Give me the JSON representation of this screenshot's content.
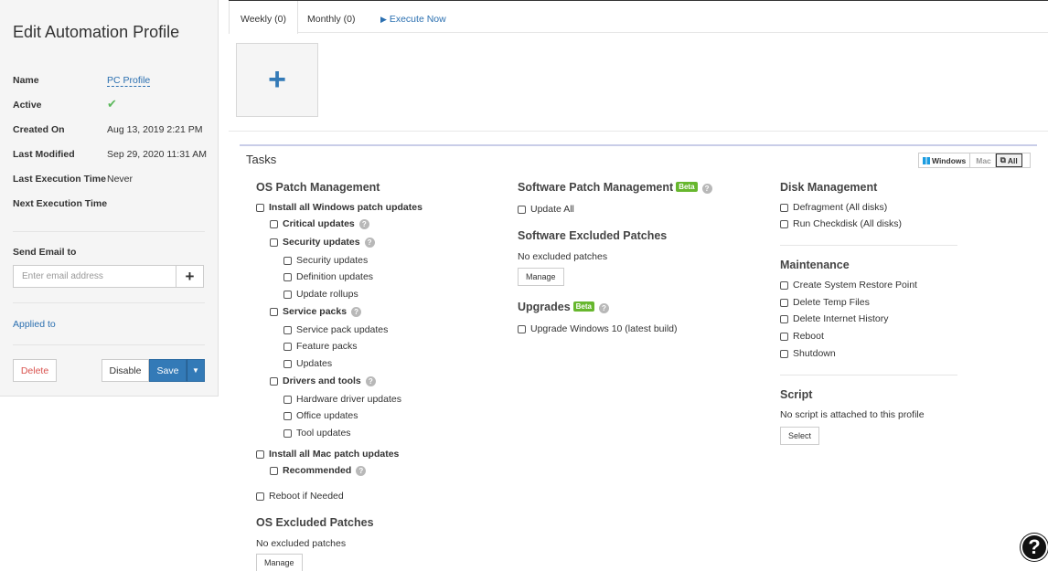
{
  "profile": {
    "title": "Edit Automation Profile",
    "name_label": "Name",
    "name_value": "PC Profile",
    "active_label": "Active",
    "created_label": "Created On",
    "created_value": "Aug 13, 2019 2:21 PM",
    "modified_label": "Last Modified",
    "modified_value": "Sep 29, 2020 11:31 AM",
    "last_exec_label": "Last Execution Time",
    "last_exec_value": "Never",
    "next_exec_label": "Next Execution Time",
    "send_email_label": "Send Email to",
    "email_placeholder": "Enter email address",
    "add_symbol": "+",
    "applied_to": "Applied to",
    "delete_label": "Delete",
    "disable_label": "Disable",
    "save_label": "Save",
    "caret": "▼"
  },
  "tabs": {
    "weekly": "Weekly (0)",
    "monthly": "Monthly (0)",
    "execute": "Execute Now"
  },
  "tasks": {
    "title": "Tasks",
    "filter": {
      "windows": "Windows",
      "mac": "Mac",
      "all": "All"
    },
    "os_patch": {
      "heading": "OS Patch Management",
      "install_windows": "Install all Windows patch updates",
      "critical": "Critical updates",
      "security_group": "Security updates",
      "security": "Security updates",
      "definition": "Definition updates",
      "rollups": "Update rollups",
      "service_packs_group": "Service packs",
      "service_pack_updates": "Service pack updates",
      "feature_packs": "Feature packs",
      "updates": "Updates",
      "drivers_group": "Drivers and tools",
      "hardware": "Hardware driver updates",
      "office": "Office updates",
      "tool": "Tool updates",
      "install_mac": "Install all Mac patch updates",
      "recommended": "Recommended",
      "reboot_needed": "Reboot if Needed"
    },
    "os_excluded": {
      "heading": "OS Excluded Patches",
      "empty": "No excluded patches",
      "manage": "Manage"
    },
    "software_patch": {
      "heading": "Software Patch Management",
      "beta": "Beta",
      "update_all": "Update All"
    },
    "software_excluded": {
      "heading": "Software Excluded Patches",
      "empty": "No excluded patches",
      "manage": "Manage"
    },
    "upgrades": {
      "heading": "Upgrades",
      "beta": "Beta",
      "win10": "Upgrade Windows 10 (latest build)"
    },
    "disk": {
      "heading": "Disk Management",
      "defrag": "Defragment (All disks)",
      "checkdisk": "Run Checkdisk (All disks)"
    },
    "maintenance": {
      "heading": "Maintenance",
      "restore": "Create System Restore Point",
      "temp": "Delete Temp Files",
      "internet": "Delete Internet History",
      "reboot": "Reboot",
      "shutdown": "Shutdown"
    },
    "script": {
      "heading": "Script",
      "empty": "No script is attached to this profile",
      "select": "Select"
    }
  },
  "colors": {
    "accent": "#337ab7",
    "link": "#2a6fb0",
    "success": "#5cb85c",
    "danger": "#d9534f",
    "beta": "#67b72e"
  }
}
